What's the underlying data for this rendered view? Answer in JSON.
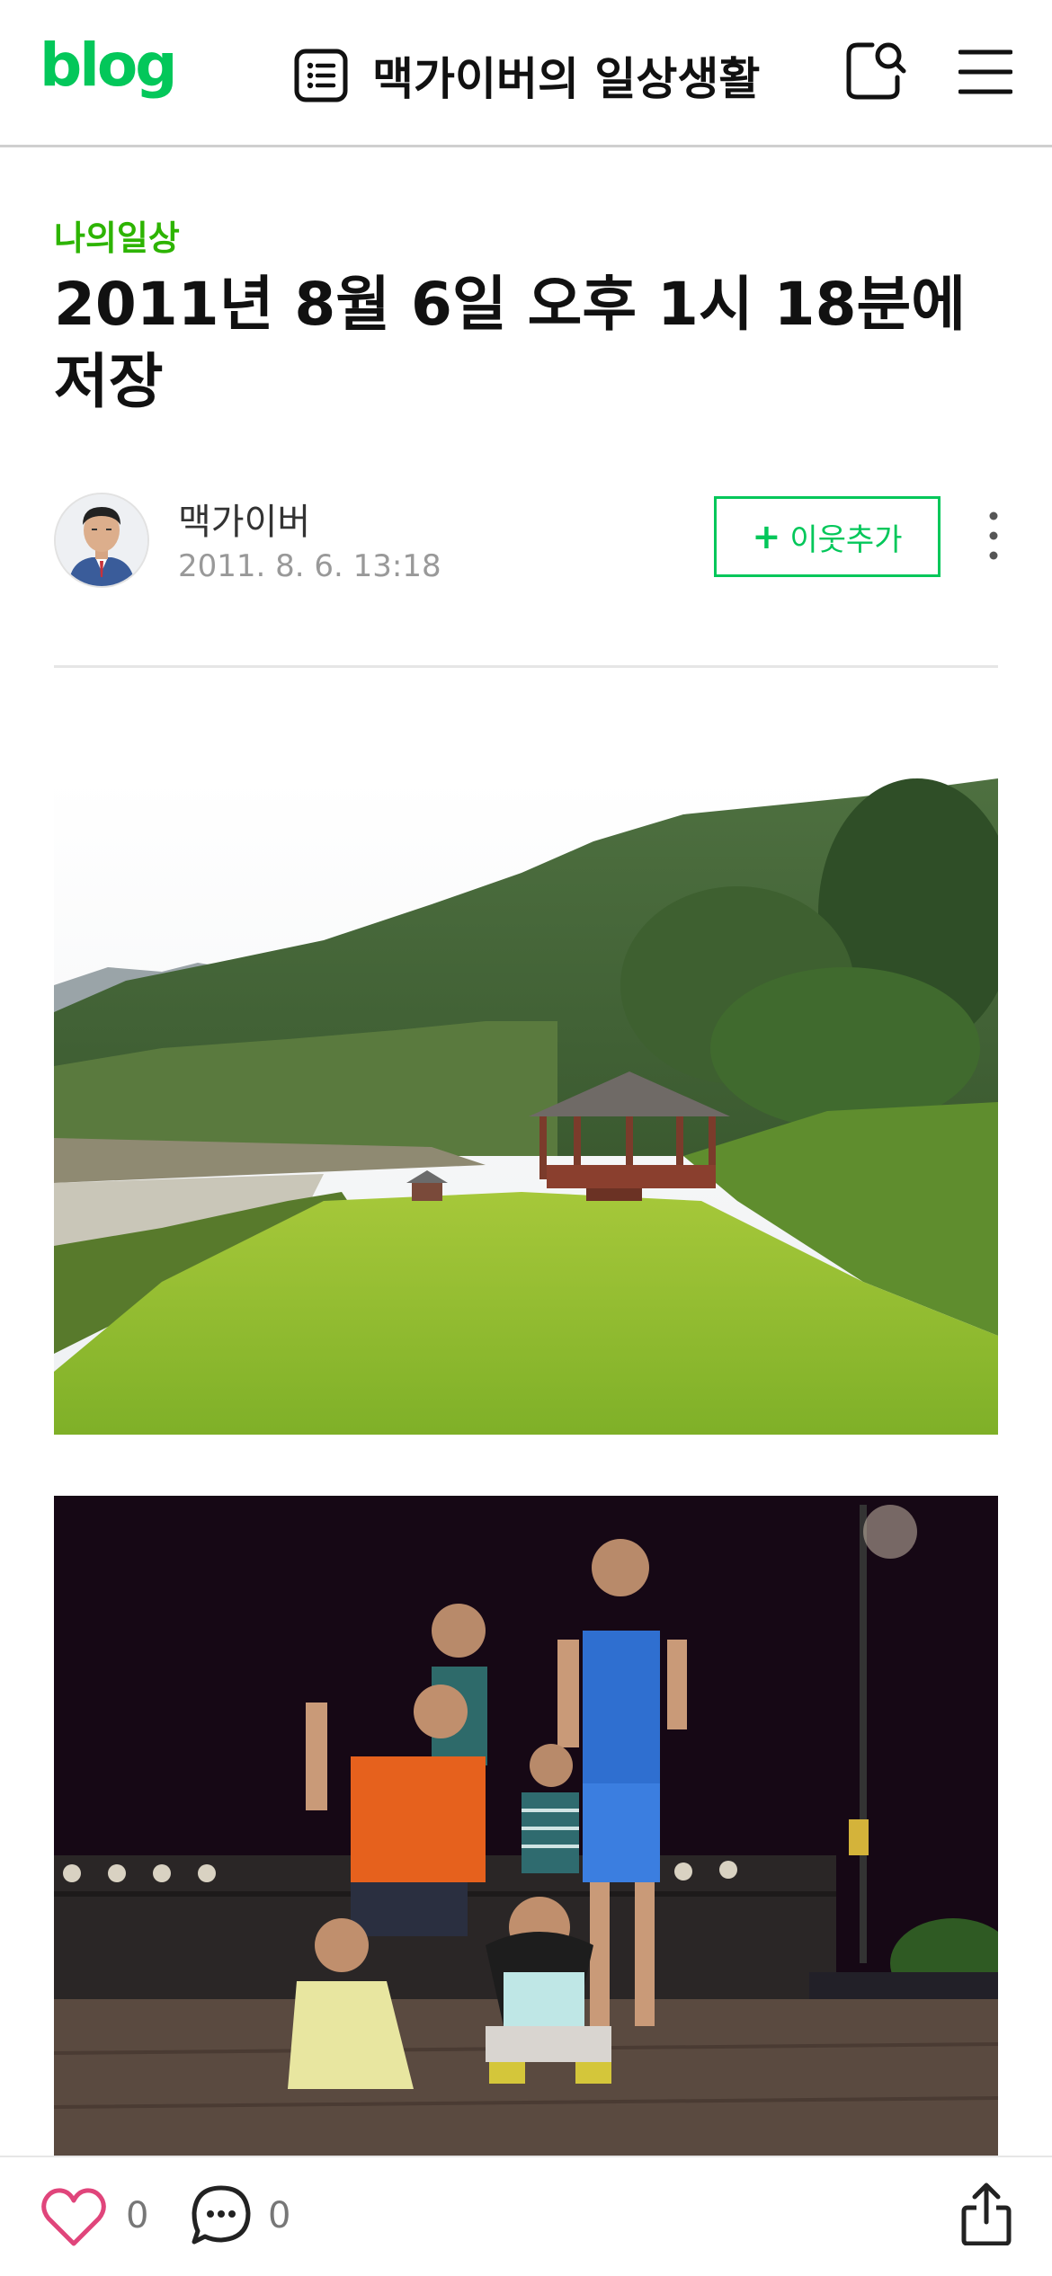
{
  "header": {
    "logo": "blog",
    "blog_title": "맥가이버의 일상생활",
    "icons": {
      "list": "list-icon",
      "search": "search-icon",
      "menu": "menu-icon"
    }
  },
  "post": {
    "category": "나의일상",
    "title": "2011년 8월 6일 오후 1시 18분에 저장",
    "author": "맥가이버",
    "date": "2011. 8. 6. 13:18",
    "add_neighbor_plus": "+",
    "add_neighbor_label": "이웃추가",
    "photos": [
      {
        "subject": "gazebo-on-lawn-mountain-landscape"
      },
      {
        "subject": "children-posing-at-night"
      }
    ]
  },
  "bottom_bar": {
    "like_count": "0",
    "comment_count": "0",
    "icons": {
      "like": "heart-icon",
      "comment": "comment-icon",
      "share": "share-icon"
    }
  },
  "colors": {
    "brand_green": "#03c75a",
    "category_green": "#2db400",
    "like_pink": "#e0457b"
  }
}
